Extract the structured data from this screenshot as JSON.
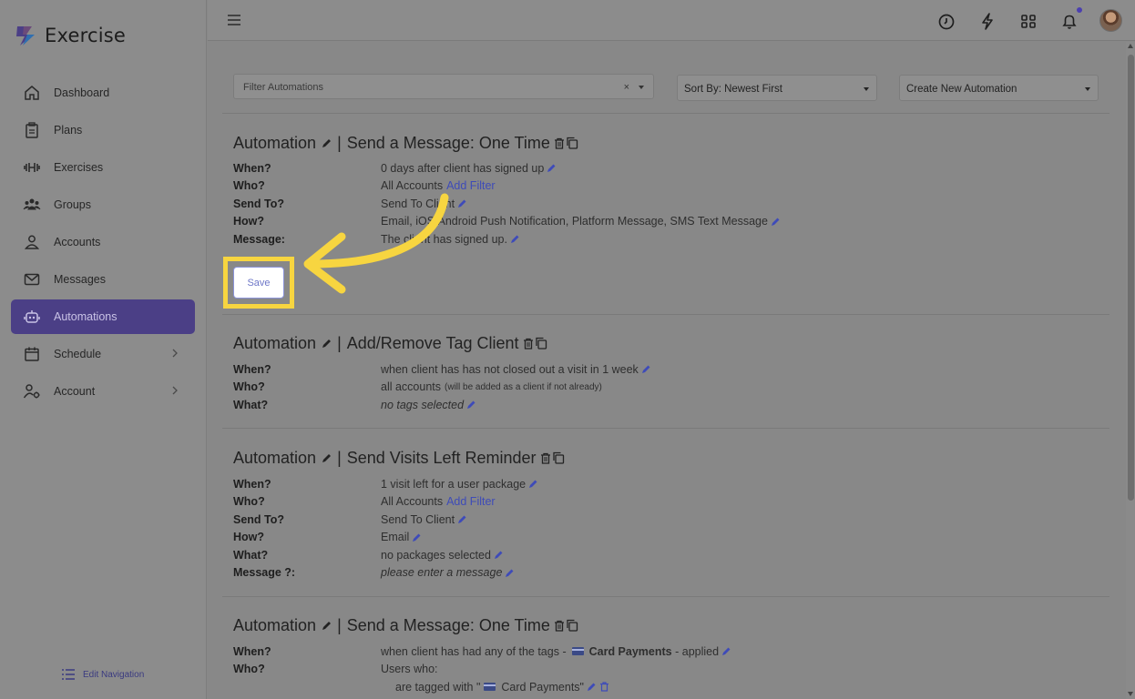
{
  "app": {
    "name": "Exercise"
  },
  "sidebar": {
    "items": [
      {
        "label": "Dashboard",
        "icon": "home-icon"
      },
      {
        "label": "Plans",
        "icon": "clipboard-icon"
      },
      {
        "label": "Exercises",
        "icon": "dumbbell-icon"
      },
      {
        "label": "Groups",
        "icon": "group-icon"
      },
      {
        "label": "Accounts",
        "icon": "user-icon"
      },
      {
        "label": "Messages",
        "icon": "mail-icon"
      },
      {
        "label": "Automations",
        "icon": "robot-icon",
        "active": true
      },
      {
        "label": "Schedule",
        "icon": "calendar-icon",
        "expandable": true
      },
      {
        "label": "Account",
        "icon": "user-gear-icon",
        "expandable": true
      }
    ],
    "edit_navigation": "Edit Navigation"
  },
  "toolbar": {
    "filter_placeholder": "Filter Automations",
    "filter_clear": "×",
    "sort_label": "Sort By: Newest First",
    "create_label": "Create New Automation"
  },
  "automations": [
    {
      "prefix": "Automation",
      "title": "Send a Message: One Time",
      "rows": [
        {
          "label": "When?",
          "value": "0 days after client has signed up"
        },
        {
          "label": "Who?",
          "value": "All Accounts",
          "link": "Add Filter"
        },
        {
          "label": "Send To?",
          "value": "Send To Client"
        },
        {
          "label": "How?",
          "value": "Email, iOS/Android Push Notification, Platform Message, SMS Text Message"
        },
        {
          "label": "Message:",
          "value": "The client has signed up."
        }
      ],
      "save_label": "Save"
    },
    {
      "prefix": "Automation",
      "title": "Add/Remove Tag Client",
      "rows": [
        {
          "label": "When?",
          "value": "when client has has not closed out a visit in 1 week"
        },
        {
          "label": "Who?",
          "value": "all accounts",
          "note": "(will be added as a client if not already)"
        },
        {
          "label": "What?",
          "value": "no tags selected"
        }
      ]
    },
    {
      "prefix": "Automation",
      "title": "Send Visits Left Reminder",
      "rows": [
        {
          "label": "When?",
          "value": "1 visit left for a user package"
        },
        {
          "label": "Who?",
          "value": "All Accounts",
          "link": "Add Filter"
        },
        {
          "label": "Send To?",
          "value": "Send To Client"
        },
        {
          "label": "How?",
          "value": "Email"
        },
        {
          "label": "What?",
          "value": "no packages selected"
        },
        {
          "label": "Message ?:",
          "value": "please enter a message"
        }
      ]
    },
    {
      "prefix": "Automation",
      "title": "Send a Message: One Time",
      "rows": [
        {
          "label": "When?",
          "value_pre": "when client has had any of the tags -",
          "tag": "Card Payments",
          "value_post": "- applied"
        },
        {
          "label": "Who?",
          "value": "Users who:"
        }
      ],
      "sub": {
        "pre": "are tagged with \"",
        "tag": "Card Payments",
        "post": "\""
      }
    }
  ],
  "colors": {
    "accent": "#4b3f86",
    "highlight": "#f7d540",
    "link": "#3e4bb8"
  }
}
